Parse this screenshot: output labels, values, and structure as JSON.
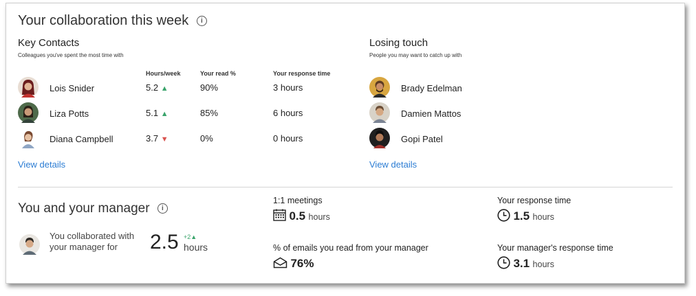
{
  "header": {
    "title": "Your collaboration this week"
  },
  "key_contacts": {
    "title": "Key Contacts",
    "subtitle": "Colleagues you've spent the most time with",
    "columns": [
      "Hours/week",
      "Your read %",
      "Your response time"
    ],
    "rows": [
      {
        "name": "Lois Snider",
        "hours": "5.2",
        "trend": "up",
        "read": "90%",
        "response": "3 hours"
      },
      {
        "name": "Liza Potts",
        "hours": "5.1",
        "trend": "up",
        "read": "85%",
        "response": "6 hours"
      },
      {
        "name": "Diana Campbell",
        "hours": "3.7",
        "trend": "down",
        "read": "0%",
        "response": "0 hours"
      }
    ],
    "link": "View details"
  },
  "losing_touch": {
    "title": "Losing touch",
    "subtitle": "People you may want to catch up with",
    "people": [
      "Brady Edelman",
      "Damien Mattos",
      "Gopi Patel"
    ],
    "link": "View details"
  },
  "manager": {
    "title": "You and your manager",
    "collab_text_line1": "You collaborated with",
    "collab_text_line2": "your manager for",
    "collab_value": "2.5",
    "collab_delta": "+2",
    "collab_unit": "hours",
    "meetings_label": "1:1 meetings",
    "meetings_value": "0.5",
    "meetings_unit": "hours",
    "emails_label": "% of emails you read from your manager",
    "emails_value": "76%",
    "your_response_label": "Your response time",
    "your_response_value": "1.5",
    "your_response_unit": "hours",
    "mgr_response_label": "Your manager's response time",
    "mgr_response_value": "3.1",
    "mgr_response_unit": "hours"
  },
  "colors": {
    "link": "#2b7cd3",
    "up": "#3aa46b",
    "down": "#d9534f"
  }
}
